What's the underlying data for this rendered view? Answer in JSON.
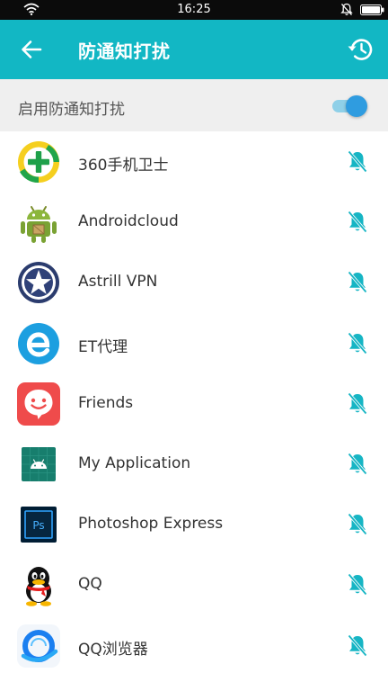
{
  "status_bar": {
    "time": "16:25"
  },
  "header": {
    "title": "防通知打扰"
  },
  "toggle": {
    "label": "启用防通知打扰",
    "enabled": true
  },
  "colors": {
    "accent": "#12b7c4",
    "switch_thumb": "#2f9ce0",
    "switch_track": "#8fd0e8",
    "bell": "#16b5c4"
  },
  "apps": [
    {
      "name": "360手机卫士",
      "icon": "app-360-icon"
    },
    {
      "name": "Androidcloud",
      "icon": "app-androidcloud-icon"
    },
    {
      "name": "Astrill VPN",
      "icon": "app-astrill-icon"
    },
    {
      "name": "ET代理",
      "icon": "app-et-icon"
    },
    {
      "name": "Friends",
      "icon": "app-friends-icon"
    },
    {
      "name": "My Application",
      "icon": "app-myapplication-icon"
    },
    {
      "name": "Photoshop Express",
      "icon": "app-photoshop-icon",
      "icon_text": "Ps"
    },
    {
      "name": "QQ",
      "icon": "app-qq-icon"
    },
    {
      "name": "QQ浏览器",
      "icon": "app-qqbrowser-icon"
    }
  ]
}
